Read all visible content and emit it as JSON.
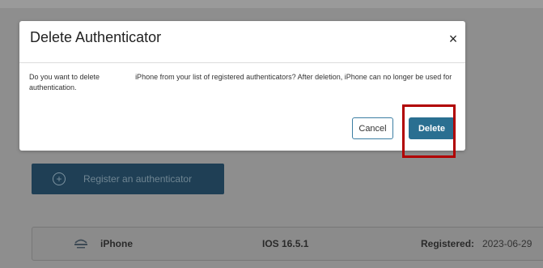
{
  "dialog": {
    "title": "Delete Authenticator",
    "close_glyph": "×",
    "message_part1": "Do you want to delete",
    "message_part2": "iPhone from your list of registered authenticators? After deletion, iPhone can no longer be used for authentication.",
    "cancel_label": "Cancel",
    "delete_label": "Delete"
  },
  "background": {
    "register_button_label": "Register an authenticator",
    "register_icon": "plus-circle-icon",
    "authenticator": {
      "icon": "device-icon",
      "name": "iPhone",
      "os": "IOS 16.5.1",
      "registered_label": "Registered:",
      "registered_date": "2023-06-29"
    }
  },
  "colors": {
    "primary": "#2a6f91",
    "overlay": "#8e8e8e",
    "highlight": "#b10000"
  }
}
